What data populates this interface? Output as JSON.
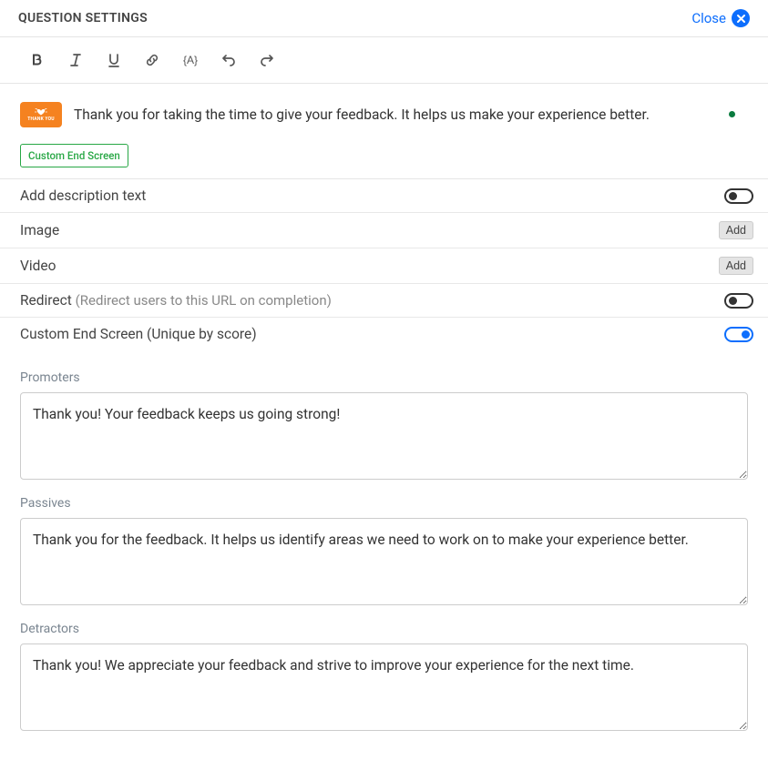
{
  "header": {
    "title": "QUESTION SETTINGS",
    "close": "Close"
  },
  "summary": {
    "thank_micro": "THANK YOU",
    "message": "Thank you for taking the time to give your feedback. It helps us make your experience better.",
    "tag": "Custom End Screen"
  },
  "settings": {
    "description": {
      "label": "Add description text",
      "on": false
    },
    "image": {
      "label": "Image",
      "button": "Add"
    },
    "video": {
      "label": "Video",
      "button": "Add"
    },
    "redirect": {
      "label": "Redirect",
      "sub": "(Redirect users to this URL on completion)",
      "on": false
    },
    "custom_end": {
      "label": "Custom End Screen (Unique by score)",
      "on": true
    }
  },
  "sections": {
    "promoters": {
      "label": "Promoters",
      "value": "Thank you! Your feedback keeps us going strong!"
    },
    "passives": {
      "label": "Passives",
      "value": "Thank you for the feedback. It helps us identify areas we need to work on to make your experience better."
    },
    "detractors": {
      "label": "Detractors",
      "value": "Thank you! We appreciate your feedback and strive to improve your experience for the next time."
    }
  }
}
